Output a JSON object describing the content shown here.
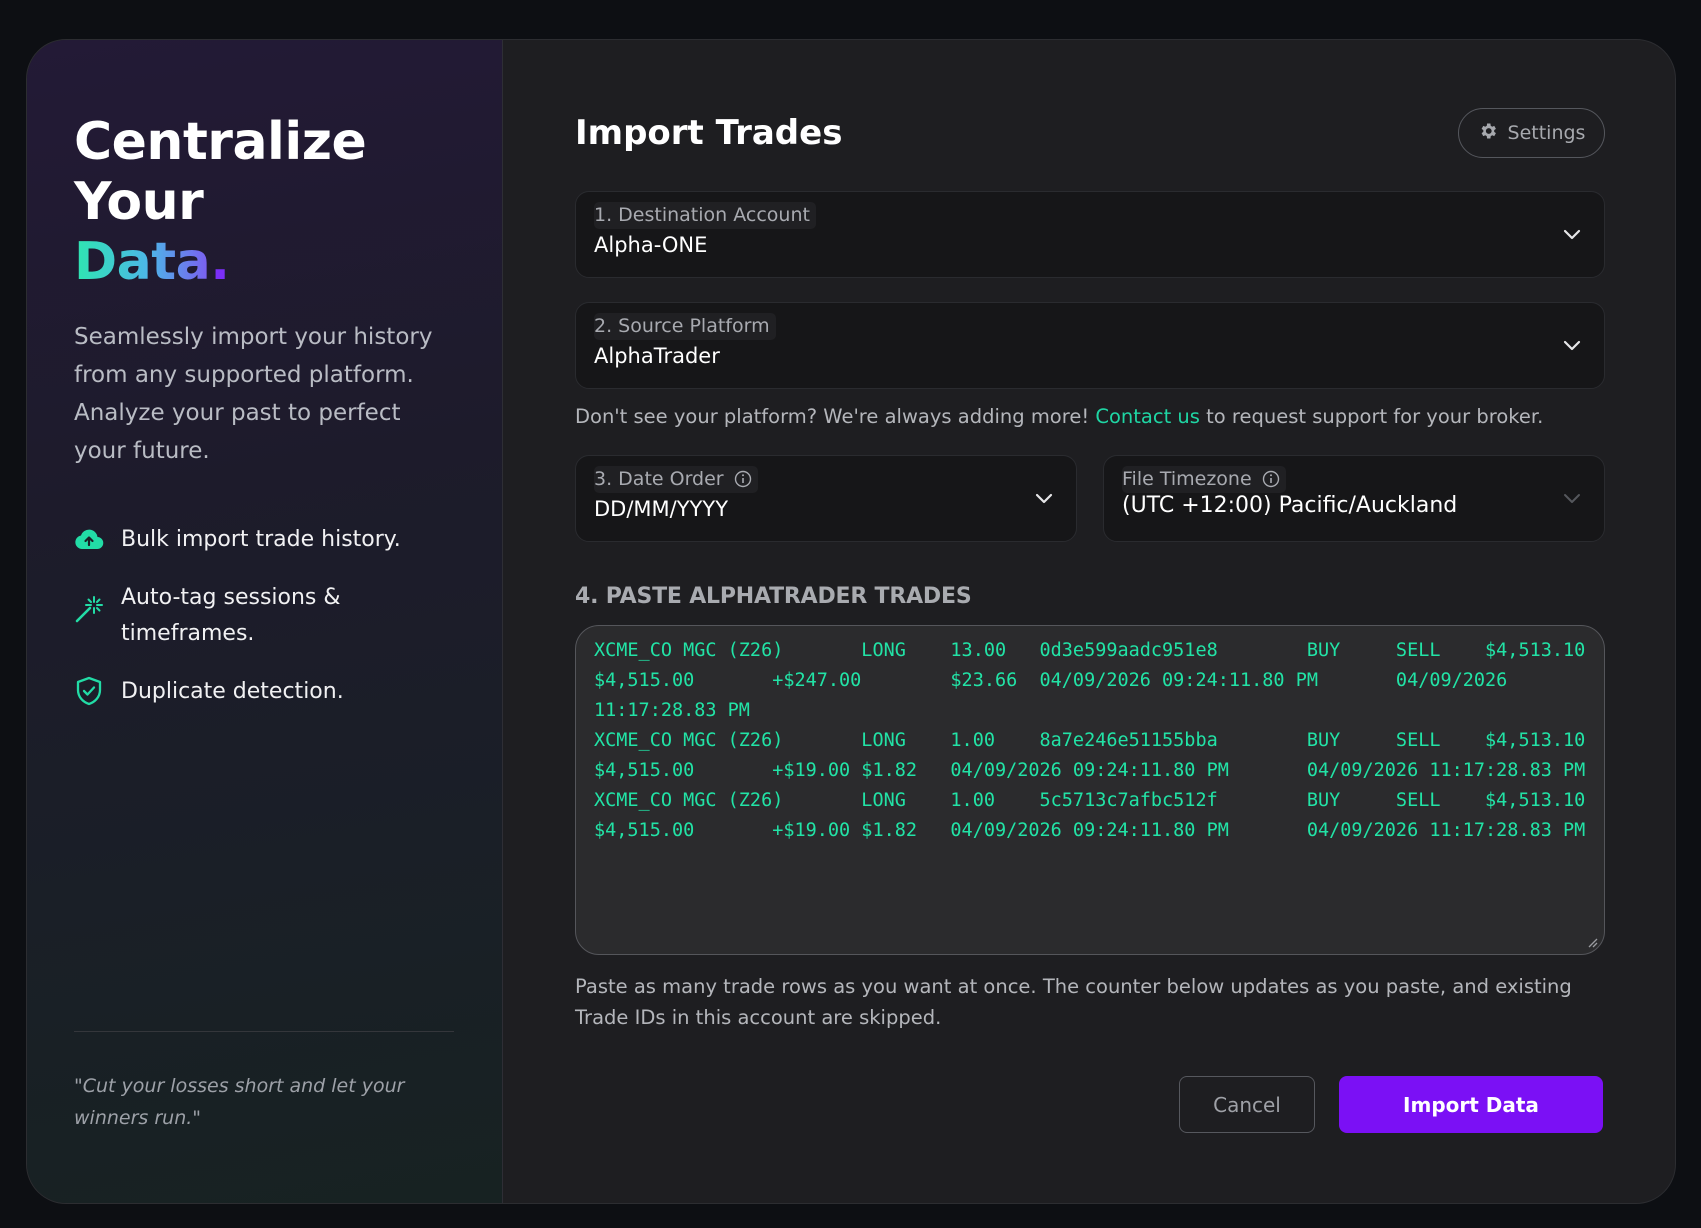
{
  "hero": {
    "title_line1": "Centralize Your",
    "title_accent": "Data",
    "title_dot": ".",
    "description": "Seamlessly import your history from any supported platform. Analyze your past to perfect your future."
  },
  "features": [
    {
      "icon": "cloud-upload-icon",
      "text": "Bulk import trade history."
    },
    {
      "icon": "magic-wand-icon",
      "text": "Auto-tag sessions & timeframes."
    },
    {
      "icon": "shield-check-icon",
      "text": "Duplicate detection."
    }
  ],
  "quote": "\"Cut your losses short and let your winners run.\"",
  "colors": {
    "accent_green": "#1fd6a4",
    "accent_purple": "#7b10f5",
    "mono_green": "#22e3a6"
  },
  "form": {
    "title": "Import Trades",
    "settings_label": "Settings",
    "destination": {
      "label": "1. Destination Account",
      "value": "Alpha-ONE"
    },
    "source": {
      "label": "2. Source Platform",
      "value": "AlphaTrader"
    },
    "hint_before": "Don't see your platform? We're always adding more! ",
    "hint_link": "Contact us",
    "hint_after": " to request support for your broker.",
    "date_order": {
      "label": "3. Date Order",
      "value": "DD/MM/YYYY"
    },
    "timezone": {
      "label": "File Timezone",
      "value": "(UTC +12:00) Pacific/Auckland"
    },
    "paste_title": "4. PASTE ALPHATRADER TRADES",
    "paste_content": "XCME_CO MGC (Z26)       LONG    13.00   0d3e599aadc951e8        BUY     SELL    $4,513.10\n$4,515.00       +$247.00        $23.66  04/09/2026 09:24:11.80 PM       04/09/2026\n11:17:28.83 PM\nXCME_CO MGC (Z26)       LONG    1.00    8a7e246e51155bba        BUY     SELL    $4,513.10\n$4,515.00       +$19.00 $1.82   04/09/2026 09:24:11.80 PM       04/09/2026 11:17:28.83 PM\nXCME_CO MGC (Z26)       LONG    1.00    5c5713c7afbc512f        BUY     SELL    $4,513.10\n$4,515.00       +$19.00 $1.82   04/09/2026 09:24:11.80 PM       04/09/2026 11:17:28.83 PM",
    "paste_help": "Paste as many trade rows as you want at once. The counter below updates as you paste, and existing Trade IDs in this account are skipped.",
    "cancel_label": "Cancel",
    "import_label": "Import Data"
  }
}
